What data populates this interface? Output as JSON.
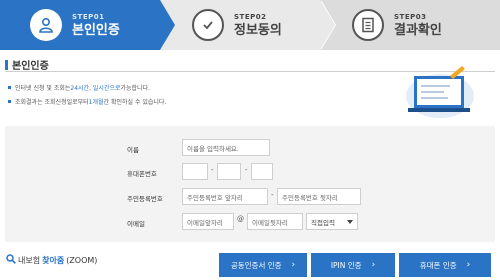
{
  "steps": [
    {
      "num": "STEP01",
      "title": "본인인증",
      "icon": "person-icon"
    },
    {
      "num": "STEP02",
      "title": "정보동의",
      "icon": "check-icon"
    },
    {
      "num": "STEP03",
      "title": "결과확인",
      "icon": "document-icon"
    }
  ],
  "section": {
    "title": "본인인증",
    "notes": [
      {
        "pre": "인터넷 신청 및 조회는 ",
        "hl": "24시간, 일시간으로",
        "post": " 가능합니다."
      },
      {
        "pre": "조회결과는 조회신청일로부터 ",
        "hl": "1개월",
        "post": "간 확인하실 수 있습니다."
      }
    ]
  },
  "form": {
    "name_label": "이름",
    "name_placeholder": "이름을 입력하세요.",
    "phone_label": "휴대폰번호",
    "rrn_label": "주민등록번호",
    "rrn_front_placeholder": "주민등록번호 앞자리",
    "rrn_back_placeholder": "주민등록번호 뒷자리",
    "email_label": "이메일",
    "email_id_placeholder": "이메일앞자리",
    "email_at": "@",
    "email_domain_placeholder": "이메일뒷자리",
    "email_select": "직접입력",
    "dash": "-"
  },
  "bottom": {
    "zoom_pre": "내보험",
    "zoom_blue": "찾아줌",
    "zoom_post": "(ZOOM)",
    "buttons": [
      "공동인증서 인증",
      "IPIN 인증",
      "휴대폰 인증"
    ]
  },
  "colors": {
    "accent": "#2a73c5"
  }
}
